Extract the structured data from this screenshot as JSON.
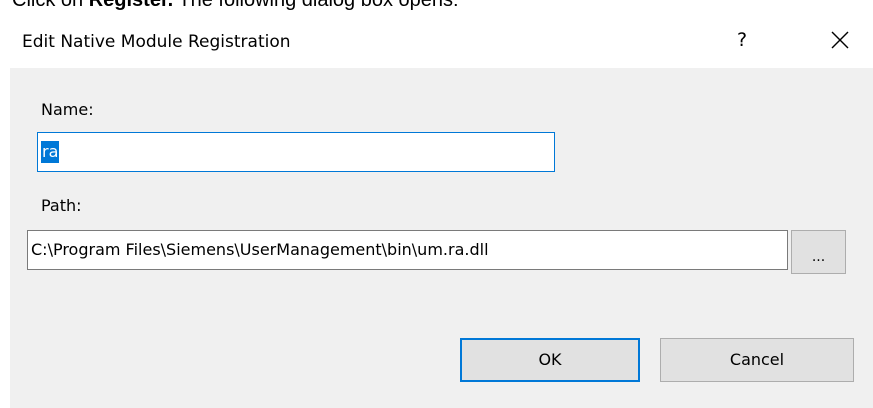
{
  "doc_caption": {
    "prefix": "Click on ",
    "emphasis": "Register.",
    "suffix": " The following dialog box opens:"
  },
  "dialog": {
    "title": "Edit Native Module Registration",
    "help_label": "?",
    "close_icon": "close-icon",
    "name_label": "Name:",
    "name_value": "ra",
    "path_label": "Path:",
    "path_value": "C:\\Program Files\\Siemens\\UserManagement\\bin\\um.ra.dll",
    "browse_label": "...",
    "ok_label": "OK",
    "cancel_label": "Cancel"
  },
  "colors": {
    "accent": "#0078d7",
    "dialog_background": "#f0f0f0",
    "button_face": "#e1e1e1"
  }
}
